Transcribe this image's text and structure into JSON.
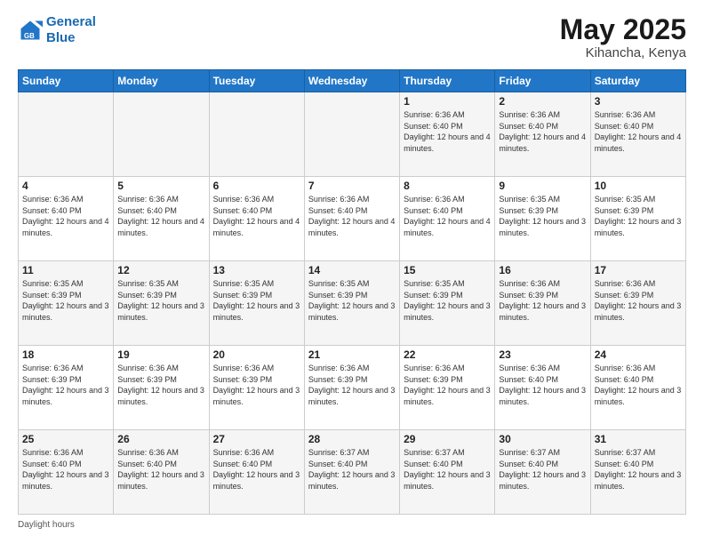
{
  "logo": {
    "line1": "General",
    "line2": "Blue"
  },
  "title": "May 2025",
  "location": "Kihancha, Kenya",
  "days_header": [
    "Sunday",
    "Monday",
    "Tuesday",
    "Wednesday",
    "Thursday",
    "Friday",
    "Saturday"
  ],
  "footer_label": "Daylight hours",
  "weeks": [
    [
      {
        "day": "",
        "sunrise": "",
        "sunset": "",
        "daylight": ""
      },
      {
        "day": "",
        "sunrise": "",
        "sunset": "",
        "daylight": ""
      },
      {
        "day": "",
        "sunrise": "",
        "sunset": "",
        "daylight": ""
      },
      {
        "day": "",
        "sunrise": "",
        "sunset": "",
        "daylight": ""
      },
      {
        "day": "1",
        "sunrise": "Sunrise: 6:36 AM",
        "sunset": "Sunset: 6:40 PM",
        "daylight": "Daylight: 12 hours and 4 minutes."
      },
      {
        "day": "2",
        "sunrise": "Sunrise: 6:36 AM",
        "sunset": "Sunset: 6:40 PM",
        "daylight": "Daylight: 12 hours and 4 minutes."
      },
      {
        "day": "3",
        "sunrise": "Sunrise: 6:36 AM",
        "sunset": "Sunset: 6:40 PM",
        "daylight": "Daylight: 12 hours and 4 minutes."
      }
    ],
    [
      {
        "day": "4",
        "sunrise": "Sunrise: 6:36 AM",
        "sunset": "Sunset: 6:40 PM",
        "daylight": "Daylight: 12 hours and 4 minutes."
      },
      {
        "day": "5",
        "sunrise": "Sunrise: 6:36 AM",
        "sunset": "Sunset: 6:40 PM",
        "daylight": "Daylight: 12 hours and 4 minutes."
      },
      {
        "day": "6",
        "sunrise": "Sunrise: 6:36 AM",
        "sunset": "Sunset: 6:40 PM",
        "daylight": "Daylight: 12 hours and 4 minutes."
      },
      {
        "day": "7",
        "sunrise": "Sunrise: 6:36 AM",
        "sunset": "Sunset: 6:40 PM",
        "daylight": "Daylight: 12 hours and 4 minutes."
      },
      {
        "day": "8",
        "sunrise": "Sunrise: 6:36 AM",
        "sunset": "Sunset: 6:40 PM",
        "daylight": "Daylight: 12 hours and 4 minutes."
      },
      {
        "day": "9",
        "sunrise": "Sunrise: 6:35 AM",
        "sunset": "Sunset: 6:39 PM",
        "daylight": "Daylight: 12 hours and 3 minutes."
      },
      {
        "day": "10",
        "sunrise": "Sunrise: 6:35 AM",
        "sunset": "Sunset: 6:39 PM",
        "daylight": "Daylight: 12 hours and 3 minutes."
      }
    ],
    [
      {
        "day": "11",
        "sunrise": "Sunrise: 6:35 AM",
        "sunset": "Sunset: 6:39 PM",
        "daylight": "Daylight: 12 hours and 3 minutes."
      },
      {
        "day": "12",
        "sunrise": "Sunrise: 6:35 AM",
        "sunset": "Sunset: 6:39 PM",
        "daylight": "Daylight: 12 hours and 3 minutes."
      },
      {
        "day": "13",
        "sunrise": "Sunrise: 6:35 AM",
        "sunset": "Sunset: 6:39 PM",
        "daylight": "Daylight: 12 hours and 3 minutes."
      },
      {
        "day": "14",
        "sunrise": "Sunrise: 6:35 AM",
        "sunset": "Sunset: 6:39 PM",
        "daylight": "Daylight: 12 hours and 3 minutes."
      },
      {
        "day": "15",
        "sunrise": "Sunrise: 6:35 AM",
        "sunset": "Sunset: 6:39 PM",
        "daylight": "Daylight: 12 hours and 3 minutes."
      },
      {
        "day": "16",
        "sunrise": "Sunrise: 6:36 AM",
        "sunset": "Sunset: 6:39 PM",
        "daylight": "Daylight: 12 hours and 3 minutes."
      },
      {
        "day": "17",
        "sunrise": "Sunrise: 6:36 AM",
        "sunset": "Sunset: 6:39 PM",
        "daylight": "Daylight: 12 hours and 3 minutes."
      }
    ],
    [
      {
        "day": "18",
        "sunrise": "Sunrise: 6:36 AM",
        "sunset": "Sunset: 6:39 PM",
        "daylight": "Daylight: 12 hours and 3 minutes."
      },
      {
        "day": "19",
        "sunrise": "Sunrise: 6:36 AM",
        "sunset": "Sunset: 6:39 PM",
        "daylight": "Daylight: 12 hours and 3 minutes."
      },
      {
        "day": "20",
        "sunrise": "Sunrise: 6:36 AM",
        "sunset": "Sunset: 6:39 PM",
        "daylight": "Daylight: 12 hours and 3 minutes."
      },
      {
        "day": "21",
        "sunrise": "Sunrise: 6:36 AM",
        "sunset": "Sunset: 6:39 PM",
        "daylight": "Daylight: 12 hours and 3 minutes."
      },
      {
        "day": "22",
        "sunrise": "Sunrise: 6:36 AM",
        "sunset": "Sunset: 6:39 PM",
        "daylight": "Daylight: 12 hours and 3 minutes."
      },
      {
        "day": "23",
        "sunrise": "Sunrise: 6:36 AM",
        "sunset": "Sunset: 6:40 PM",
        "daylight": "Daylight: 12 hours and 3 minutes."
      },
      {
        "day": "24",
        "sunrise": "Sunrise: 6:36 AM",
        "sunset": "Sunset: 6:40 PM",
        "daylight": "Daylight: 12 hours and 3 minutes."
      }
    ],
    [
      {
        "day": "25",
        "sunrise": "Sunrise: 6:36 AM",
        "sunset": "Sunset: 6:40 PM",
        "daylight": "Daylight: 12 hours and 3 minutes."
      },
      {
        "day": "26",
        "sunrise": "Sunrise: 6:36 AM",
        "sunset": "Sunset: 6:40 PM",
        "daylight": "Daylight: 12 hours and 3 minutes."
      },
      {
        "day": "27",
        "sunrise": "Sunrise: 6:36 AM",
        "sunset": "Sunset: 6:40 PM",
        "daylight": "Daylight: 12 hours and 3 minutes."
      },
      {
        "day": "28",
        "sunrise": "Sunrise: 6:37 AM",
        "sunset": "Sunset: 6:40 PM",
        "daylight": "Daylight: 12 hours and 3 minutes."
      },
      {
        "day": "29",
        "sunrise": "Sunrise: 6:37 AM",
        "sunset": "Sunset: 6:40 PM",
        "daylight": "Daylight: 12 hours and 3 minutes."
      },
      {
        "day": "30",
        "sunrise": "Sunrise: 6:37 AM",
        "sunset": "Sunset: 6:40 PM",
        "daylight": "Daylight: 12 hours and 3 minutes."
      },
      {
        "day": "31",
        "sunrise": "Sunrise: 6:37 AM",
        "sunset": "Sunset: 6:40 PM",
        "daylight": "Daylight: 12 hours and 3 minutes."
      }
    ]
  ]
}
